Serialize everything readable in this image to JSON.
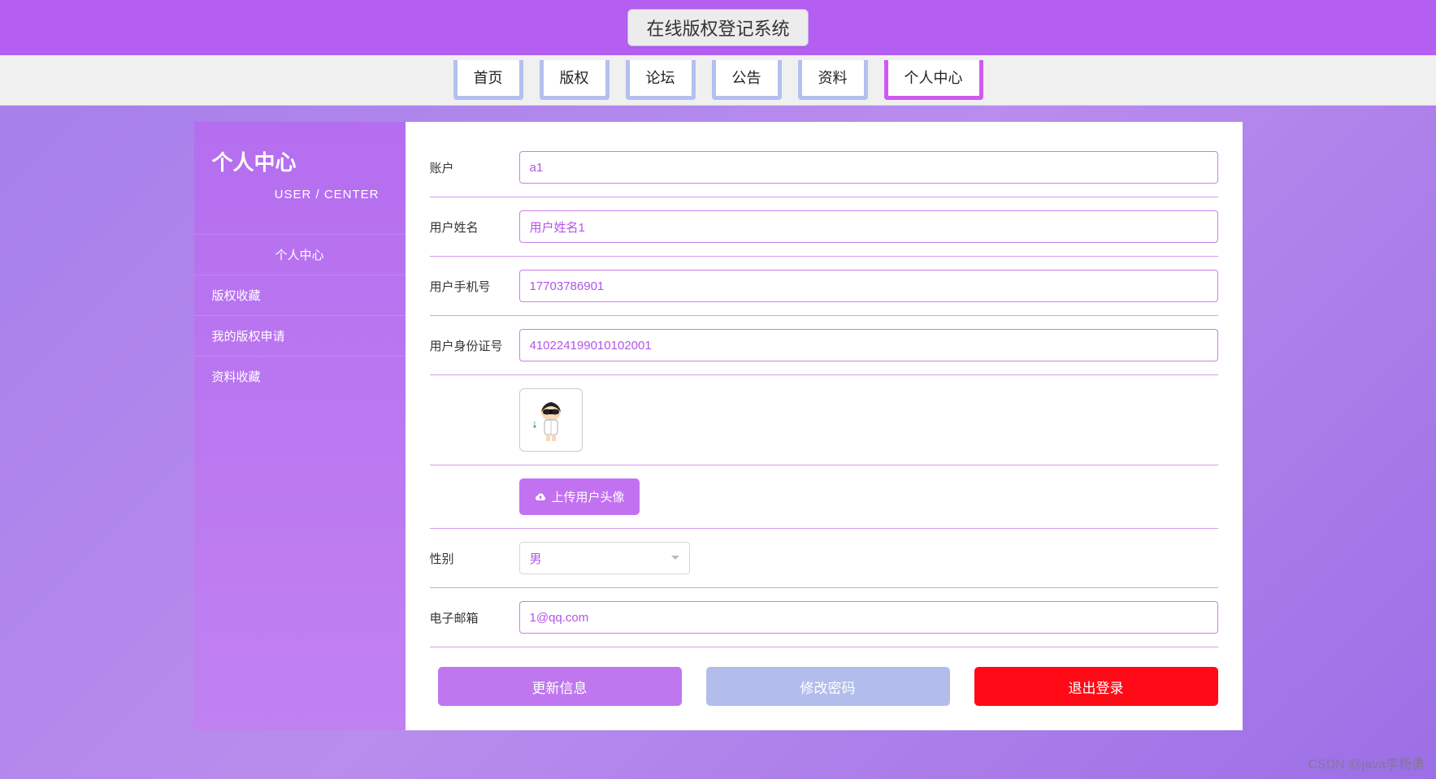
{
  "header": {
    "title": "在线版权登记系统"
  },
  "nav": {
    "items": [
      {
        "label": "首页"
      },
      {
        "label": "版权"
      },
      {
        "label": "论坛"
      },
      {
        "label": "公告"
      },
      {
        "label": "资料"
      },
      {
        "label": "个人中心"
      }
    ],
    "activeIndex": 5
  },
  "sidebar": {
    "title": "个人中心",
    "subtitle": "USER / CENTER",
    "items": [
      {
        "label": "个人中心"
      },
      {
        "label": "版权收藏"
      },
      {
        "label": "我的版权申请"
      },
      {
        "label": "资料收藏"
      }
    ],
    "activeIndex": 0
  },
  "form": {
    "account": {
      "label": "账户",
      "value": "a1"
    },
    "username": {
      "label": "用户姓名",
      "value": "用户姓名1"
    },
    "phone": {
      "label": "用户手机号",
      "value": "17703786901"
    },
    "idcard": {
      "label": "用户身份证号",
      "value": "410224199010102001"
    },
    "avatar": {
      "uploadLabel": "上传用户头像"
    },
    "gender": {
      "label": "性别",
      "value": "男"
    },
    "email": {
      "label": "电子邮箱",
      "value": "1@qq.com"
    }
  },
  "buttons": {
    "update": "更新信息",
    "changePwd": "修改密码",
    "logout": "退出登录"
  },
  "watermark": "CSDN @java李杨勇"
}
